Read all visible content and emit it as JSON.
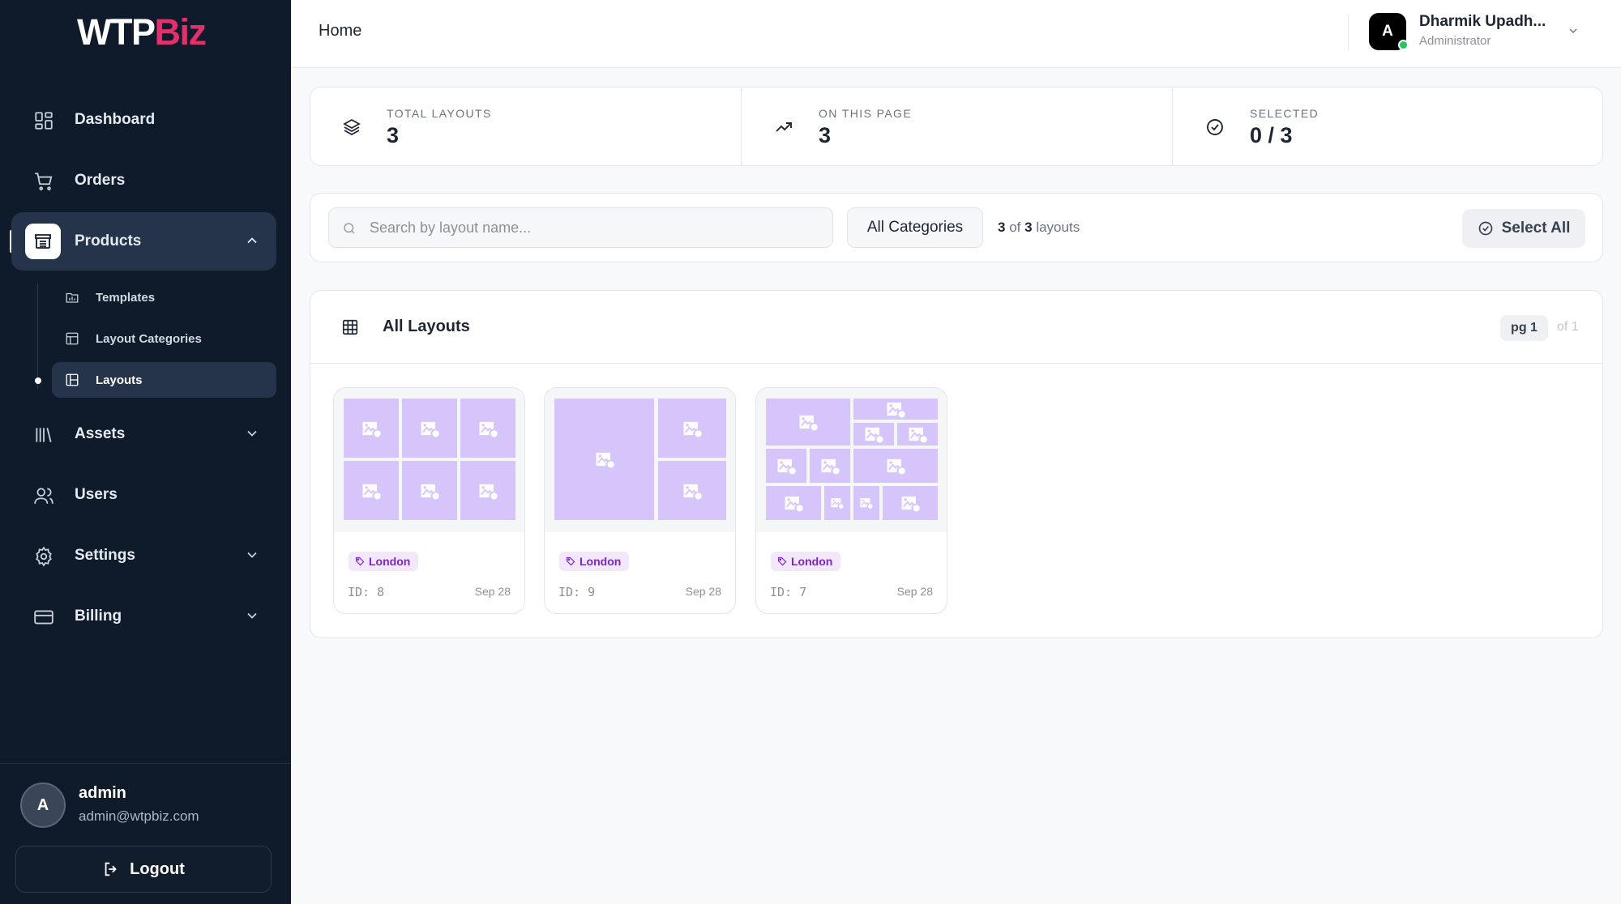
{
  "brand": {
    "part1": "WTP",
    "part2": "Biz",
    "accent_color": "#e1306c"
  },
  "sidebar": {
    "items": [
      {
        "label": "Dashboard",
        "icon": "grid-icon"
      },
      {
        "label": "Orders",
        "icon": "cart-icon"
      },
      {
        "label": "Products",
        "icon": "archive-icon",
        "expanded": true
      },
      {
        "label": "Assets",
        "icon": "library-icon"
      },
      {
        "label": "Users",
        "icon": "users-icon"
      },
      {
        "label": "Settings",
        "icon": "gear-icon"
      },
      {
        "label": "Billing",
        "icon": "credit-card-icon"
      }
    ],
    "products_sub": [
      {
        "label": "Templates",
        "icon": "template-icon"
      },
      {
        "label": "Layout Categories",
        "icon": "layout-icon"
      },
      {
        "label": "Layouts",
        "icon": "layout-icon",
        "active": true
      }
    ],
    "user": {
      "initial": "A",
      "name": "admin",
      "email": "admin@wtpbiz.com"
    },
    "logout_label": "Logout"
  },
  "header": {
    "breadcrumb": "Home",
    "profile": {
      "initial": "A",
      "name": "Dharmik Upadh...",
      "role": "Administrator"
    }
  },
  "stats": [
    {
      "label": "TOTAL LAYOUTS",
      "value": "3",
      "icon": "layers-icon"
    },
    {
      "label": "ON THIS PAGE",
      "value": "3",
      "icon": "trending-up-icon"
    },
    {
      "label": "SELECTED",
      "value": "0 / 3",
      "icon": "check-circle-icon"
    }
  ],
  "filters": {
    "search_placeholder": "Search by layout name...",
    "category": "All Categories",
    "count_shown": "3",
    "count_of": "of",
    "count_total": "3",
    "count_suffix": "layouts",
    "select_all_label": "Select All"
  },
  "section": {
    "title": "All Layouts",
    "page_label": "pg 1",
    "page_of": "of 1"
  },
  "layouts": [
    {
      "category": "London",
      "id_label": "ID: 8",
      "date": "Sep 28"
    },
    {
      "category": "London",
      "id_label": "ID: 9",
      "date": "Sep 28"
    },
    {
      "category": "London",
      "id_label": "ID: 7",
      "date": "Sep 28"
    }
  ],
  "colors": {
    "sidebar_bg": "#0f1a2b",
    "tile": "#d6c5fa",
    "tag_text": "#7e22ce",
    "tag_bg": "#f3e8fb",
    "online": "#22c55e"
  }
}
